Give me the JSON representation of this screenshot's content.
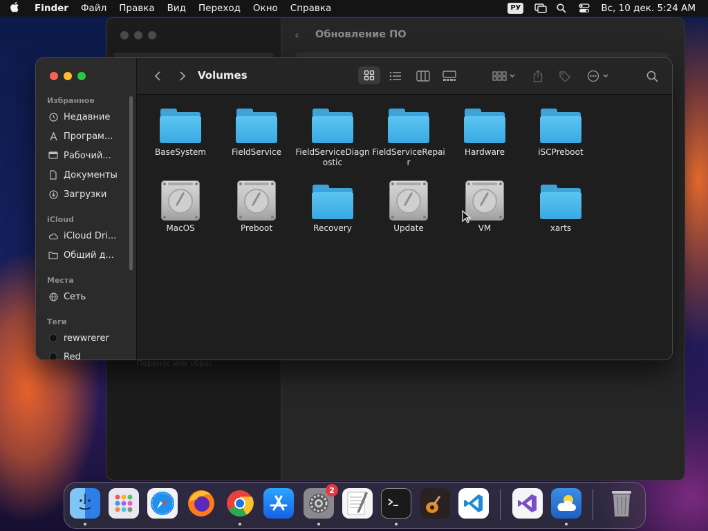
{
  "menubar": {
    "app_name": "Finder",
    "items": [
      "Файл",
      "Правка",
      "Вид",
      "Переход",
      "Окно",
      "Справка"
    ],
    "input_source": "РУ",
    "datetime": "Вс, 10 дек.  5:24 AM"
  },
  "background_window": {
    "title": "Обновление ПО",
    "faded_text": "Перенос или сброс"
  },
  "finder": {
    "title": "Volumes",
    "sidebar": {
      "favorites_header": "Избранное",
      "favorites": [
        "Недавние",
        "Програм...",
        "Рабочий...",
        "Документы",
        "Загрузки"
      ],
      "icloud_header": "iCloud",
      "icloud": [
        "iCloud Dri...",
        "Общий д..."
      ],
      "locations_header": "Места",
      "locations": [
        "Сеть"
      ],
      "tags_header": "Теги",
      "tags": [
        {
          "name": "rewwrerer",
          "color": "#111111"
        },
        {
          "name": "Red",
          "color": "#111111"
        }
      ]
    },
    "items": [
      {
        "name": "BaseSystem",
        "kind": "folder"
      },
      {
        "name": "FieldService",
        "kind": "folder"
      },
      {
        "name": "FieldServiceDiagnostic",
        "kind": "folder"
      },
      {
        "name": "FieldServiceRepair",
        "kind": "folder"
      },
      {
        "name": "Hardware",
        "kind": "folder"
      },
      {
        "name": "iSCPreboot",
        "kind": "folder"
      },
      {
        "name": "MacOS",
        "kind": "disk"
      },
      {
        "name": "Preboot",
        "kind": "disk"
      },
      {
        "name": "Recovery",
        "kind": "folder"
      },
      {
        "name": "Update",
        "kind": "disk"
      },
      {
        "name": "VM",
        "kind": "disk"
      },
      {
        "name": "xarts",
        "kind": "folder"
      }
    ]
  },
  "dock": {
    "apps": [
      "finder",
      "launchpad",
      "safari",
      "firefox",
      "chrome",
      "app-store",
      "system-settings",
      "textedit",
      "terminal",
      "garageband",
      "vscode",
      "visual-studio",
      "weather",
      "trash"
    ],
    "settings_badge": "2"
  },
  "colors": {
    "folder_blue": "#3ea3d8",
    "close": "#fe5f57",
    "minimize": "#febc2e",
    "zoom": "#28c840"
  }
}
